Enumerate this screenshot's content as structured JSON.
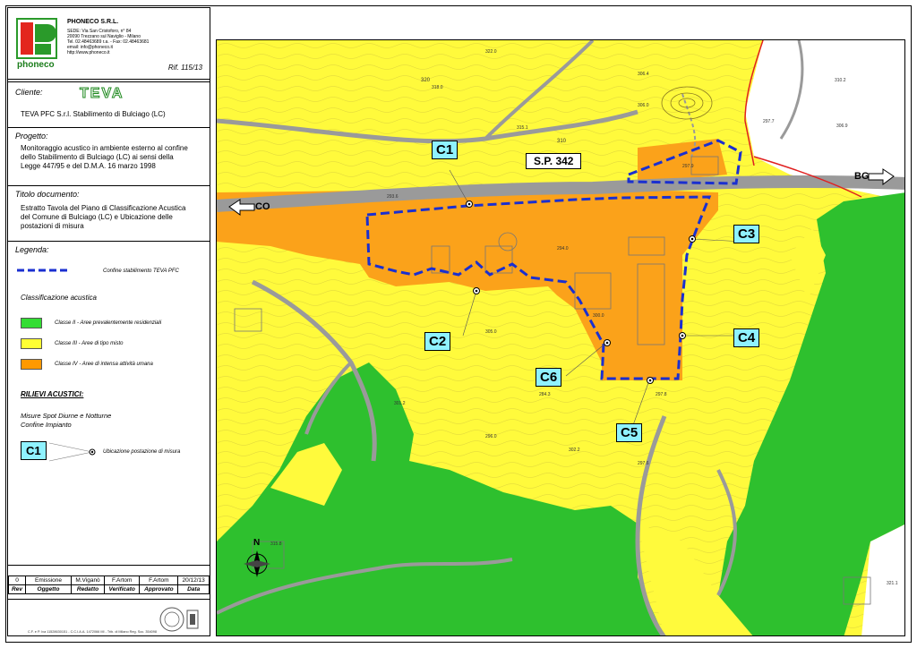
{
  "company": {
    "name": "PHONECO S.R.L.",
    "address1": "SEDE: Via San Cristoforo, n° 84",
    "address2": "20090 Trezzano sul Naviglio - Milano",
    "phone": "Tel. 02.48463689 r.a. - Fax: 02.48463681",
    "email": "email: info@phoneco.it",
    "web": "http://www.phoneco.it",
    "logo_text": "phoneco",
    "ref": "Rif. 115/13"
  },
  "client": {
    "label": "Cliente:",
    "logo_text": "TEVA",
    "name": "TEVA PFC S.r.l. Stabilimento di Bulciago (LC)"
  },
  "project": {
    "label": "Progetto:",
    "text": "Monitoraggio acustico in ambiente esterno al confine dello Stabilimento di Bulciago (LC) ai sensi della Legge 447/95 e del D.M.A. 16 marzo 1998"
  },
  "doc": {
    "label": "Titolo documento:",
    "text": "Estratto Tavola del Piano di Classificazione Acustica del Comune di Bulciago (LC) e Ubicazione delle postazioni di misura"
  },
  "legend": {
    "label": "Legenda:",
    "boundary": "Confine stabilimento TEVA PFC",
    "class_title": "Classificazione acustica",
    "classes": [
      {
        "text": "Classe II - Aree prevalentemente residenziali",
        "color": "#33dd33"
      },
      {
        "text": "Classe III - Aree di tipo misto",
        "color": "#ffff33"
      },
      {
        "text": "Classe IV - Aree di intensa attività umana",
        "color": "#ff9900"
      }
    ],
    "surveys_title": "RILIEVI ACUSTICI:",
    "surveys_sub1": "Misure Spot Diurne e Notturne",
    "surveys_sub2": "Confine Impianto",
    "marker_label": "C1",
    "marker_desc": "Ubicazione postazione di misura"
  },
  "revisions": {
    "row": [
      "0",
      "Emissione",
      "M.Viganò",
      "F.Artom",
      "F.Artom",
      "20/12/13"
    ],
    "headers": [
      "Rev",
      "Oggetto",
      "Redatto",
      "Verificato",
      "Approvato",
      "Data"
    ]
  },
  "footer": {
    "text": "C.F. e P. Iva 11528630151 - C.C.I.A.A. 1472066 MI - Trib. di Milano Reg. Soc. 354098"
  },
  "map": {
    "road_label": "S.P. 342",
    "dir_left": "CO",
    "dir_right": "BG",
    "north": "N",
    "points": [
      "C1",
      "C2",
      "C3",
      "C4",
      "C5",
      "C6"
    ],
    "colors": {
      "class2": "#2ec02e",
      "class3": "#fffa3c",
      "class4": "#fba21a",
      "road": "#9a9a9a",
      "boundary": "#1a2fd0"
    },
    "elevations": [
      "322.0",
      "320",
      "318.0",
      "315.1",
      "310",
      "306.4",
      "306.0",
      "297.9",
      "293.6",
      "294.0",
      "300.0",
      "301.2",
      "284.3",
      "297.8",
      "296.0",
      "297.6",
      "305.0",
      "302.2",
      "315.8",
      "321.1",
      "297.7",
      "310.2",
      "306.9"
    ]
  }
}
